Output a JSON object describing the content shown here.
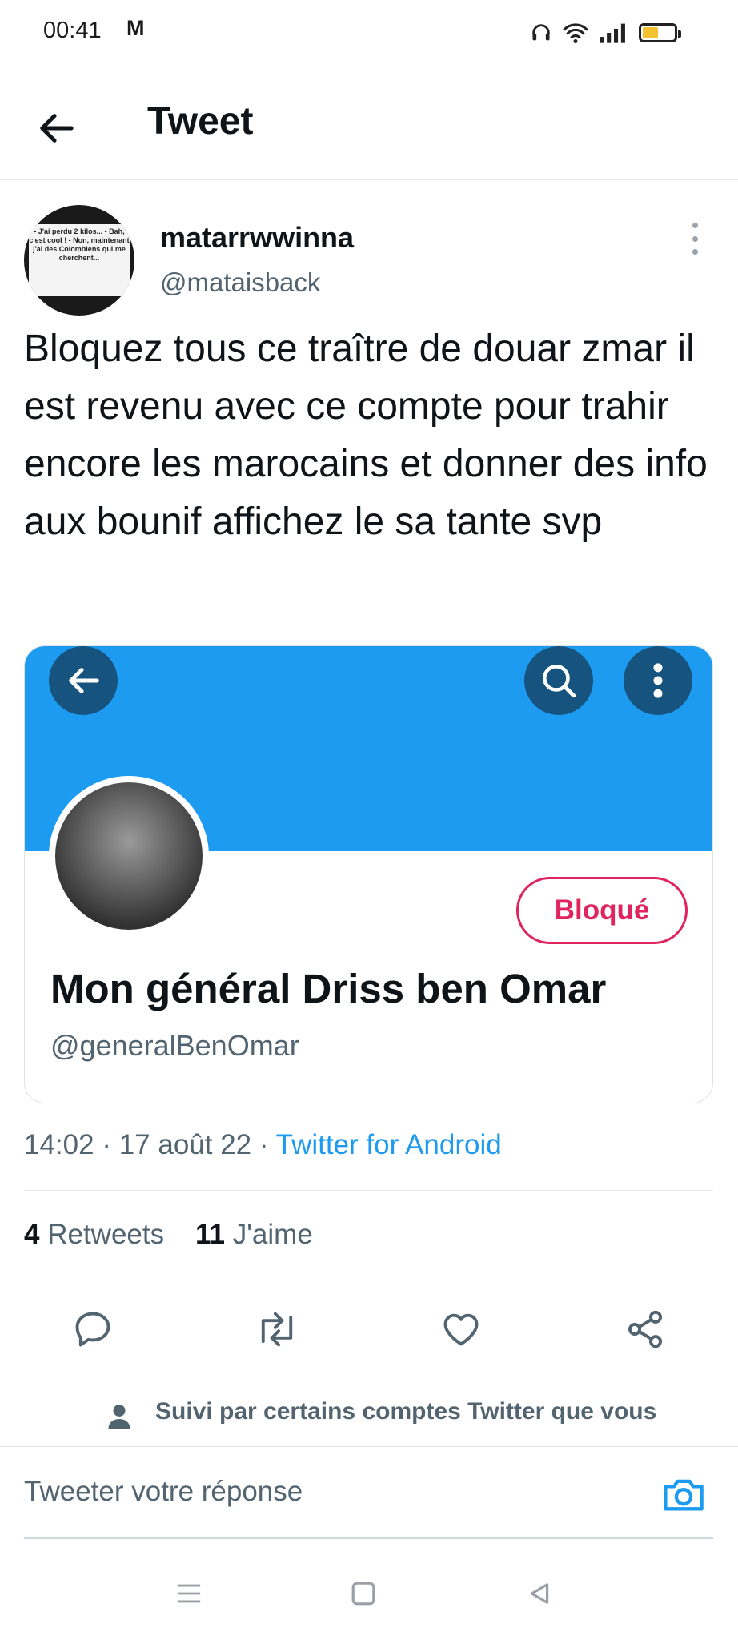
{
  "status_bar": {
    "time": "00:41",
    "mail_glyph": "M",
    "icons": [
      "headphones-icon",
      "wifi-icon",
      "signal-icon",
      "battery-icon"
    ],
    "battery_level": 0.5
  },
  "header": {
    "title": "Tweet",
    "back_icon": "arrow-left-icon"
  },
  "tweet": {
    "author_name": "matarrwwinna",
    "author_handle": "@mataisback",
    "avatar_text": "- J'ai perdu 2 kilos... - Bah, c'est cool ! - Non, maintenant j'ai des Colombiens qui me cherchent...",
    "text": "Bloquez tous ce traître de douar zmar il est revenu avec ce compte pour trahir encore les marocains et donner des info aux bounif affichez le sa tante svp",
    "card": {
      "blocked_label": "Bloqué",
      "name": "Mon général Driss ben Omar",
      "handle": "@generalBenOmar"
    },
    "time": "14:02",
    "date": "17 août 22",
    "source": "Twitter for Android",
    "separator": "·",
    "retweets_count": "4",
    "retweets_label": "Retweets",
    "likes_count": "11",
    "likes_label": "J'aime"
  },
  "actions": [
    "reply-icon",
    "retweet-icon",
    "like-icon",
    "share-icon"
  ],
  "followed_by": "Suivi par certains comptes Twitter que vous",
  "reply": {
    "placeholder": "Tweeter votre réponse"
  },
  "colors": {
    "accent": "#1d9bf0",
    "banner_button": "#16537e",
    "blocked": "#e0245e",
    "secondary_text": "#536471"
  }
}
